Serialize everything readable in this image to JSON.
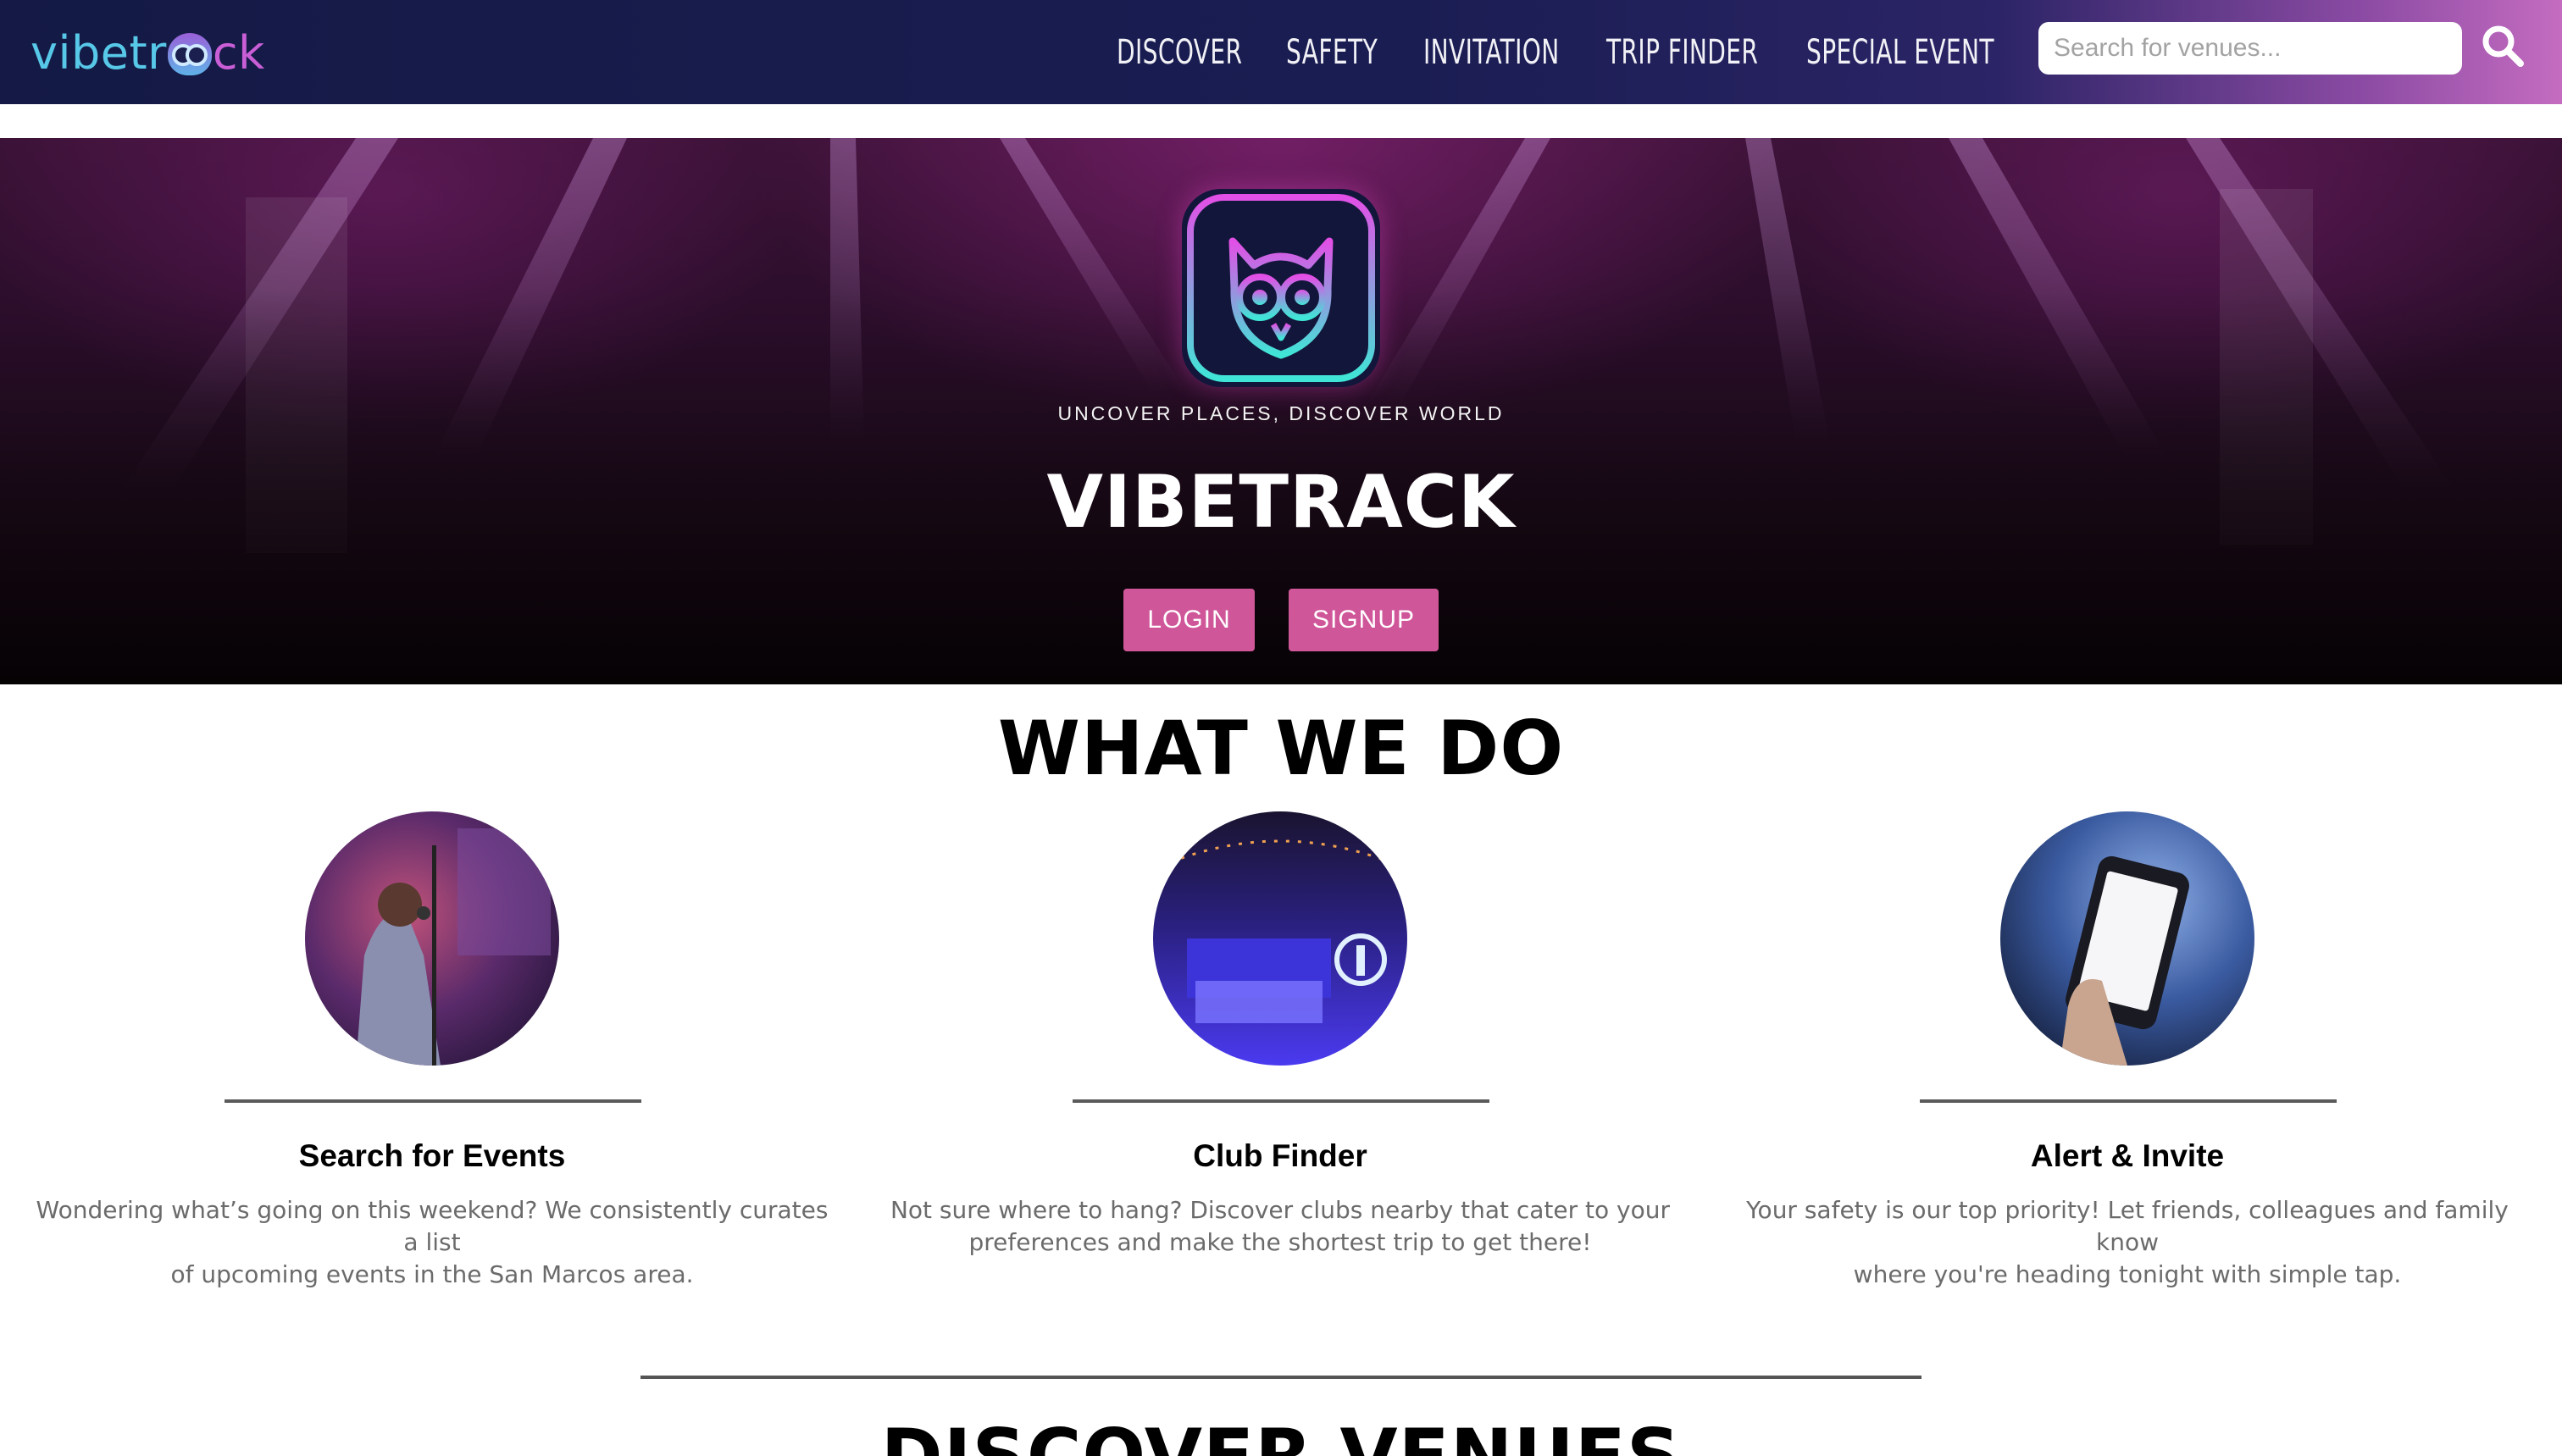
{
  "brand": {
    "part1": "vibetr",
    "part2": "ck",
    "logo_icon": "owl-icon"
  },
  "nav": {
    "items": [
      "DISCOVER",
      "SAFETY",
      "INVITATION",
      "TRIP FINDER",
      "SPECIAL EVENT"
    ]
  },
  "search": {
    "placeholder": "Search for venues...",
    "icon": "search-icon"
  },
  "hero": {
    "tagline": "UNCOVER PLACES, DISCOVER WORLD",
    "title": "VIBETRACK",
    "login_label": "LOGIN",
    "signup_label": "SIGNUP",
    "logo_icon": "owl-app-icon"
  },
  "what_we_do": {
    "title": "WHAT WE DO",
    "features": [
      {
        "title": "Search for Events",
        "desc_line1": "Wondering what’s going on this weekend? We consistently curates a list",
        "desc_line2": "of upcoming events in the San Marcos area.",
        "image": "singer-performing-image"
      },
      {
        "title": "Club Finder",
        "desc_line1": "Not sure where to hang? Discover clubs nearby that cater to your",
        "desc_line2": "preferences and make the shortest trip to get there!",
        "image": "club-lounge-image"
      },
      {
        "title": "Alert & Invite",
        "desc_line1": "Your safety is our top priority! Let friends, colleagues and family know",
        "desc_line2": "where you're heading tonight with simple tap.",
        "image": "phone-in-hand-image"
      }
    ]
  },
  "discover": {
    "title": "DISCOVER VENUES"
  },
  "colors": {
    "accent": "#d0569a",
    "nav_dark": "#1a1d52",
    "brand_cyan": "#57c8e8",
    "brand_purple": "#c95ed7"
  }
}
